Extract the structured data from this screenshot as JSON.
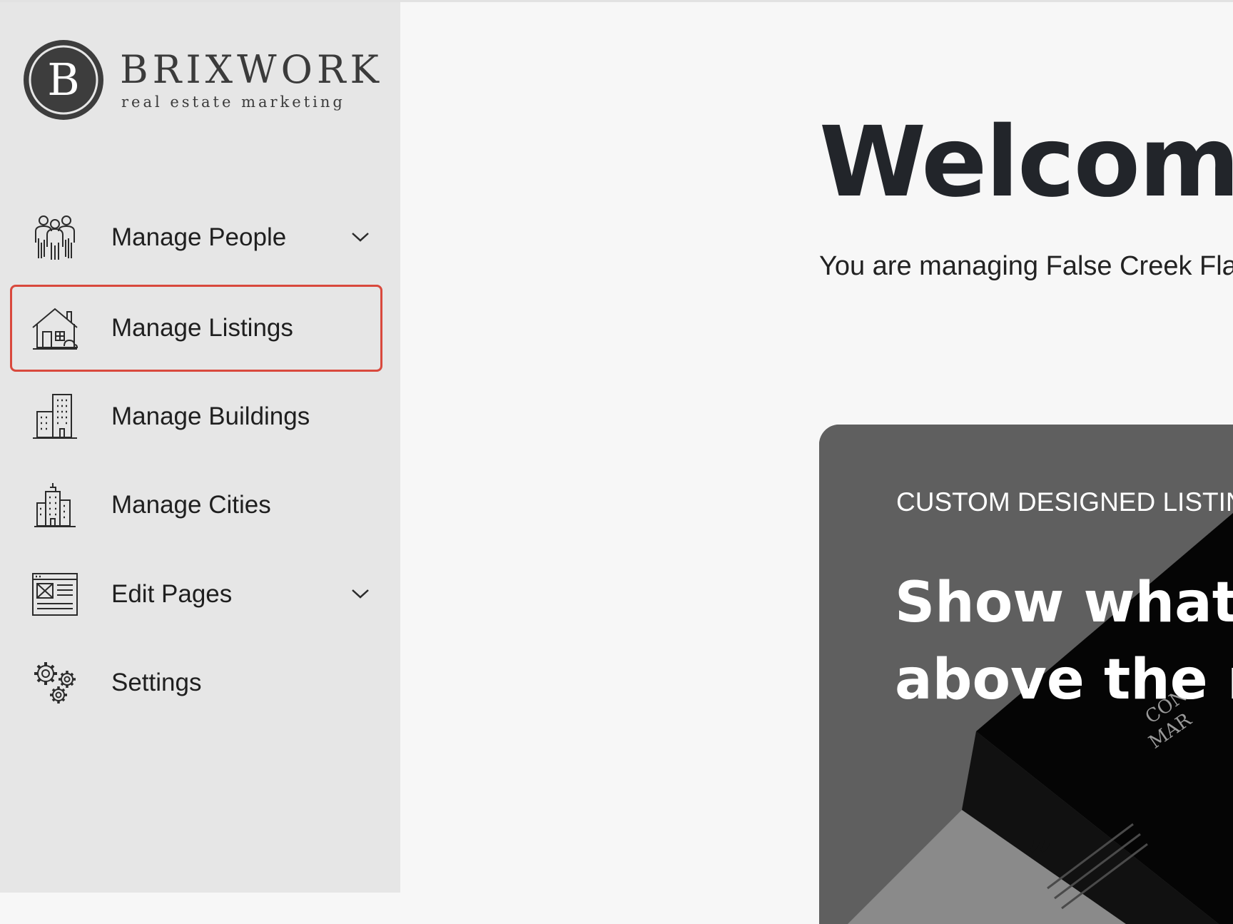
{
  "brand": {
    "mark_letter": "B",
    "name": "BRIXWORK",
    "tagline": "real estate marketing"
  },
  "sidebar": {
    "items": [
      {
        "label": "Manage People",
        "icon": "people-icon",
        "has_dropdown": true
      },
      {
        "label": "Manage Listings",
        "icon": "house-icon",
        "active": true
      },
      {
        "label": "Manage Buildings",
        "icon": "building-icon"
      },
      {
        "label": "Manage Cities",
        "icon": "city-icon"
      },
      {
        "label": "Edit Pages",
        "icon": "page-layout-icon",
        "has_dropdown": true
      },
      {
        "label": "Settings",
        "icon": "gears-icon"
      }
    ]
  },
  "main": {
    "title": "Welcom",
    "subtitle": "You are managing False Creek Fla",
    "hero": {
      "eyebrow": "CUSTOM DESIGNED LISTIN",
      "headline_line1": "Show what",
      "headline_line2": "above the r"
    }
  },
  "colors": {
    "sidebar_bg": "#e6e6e6",
    "page_bg": "#f7f7f7",
    "active_border": "#d9493d",
    "hero_bg": "#5f5f5f"
  }
}
